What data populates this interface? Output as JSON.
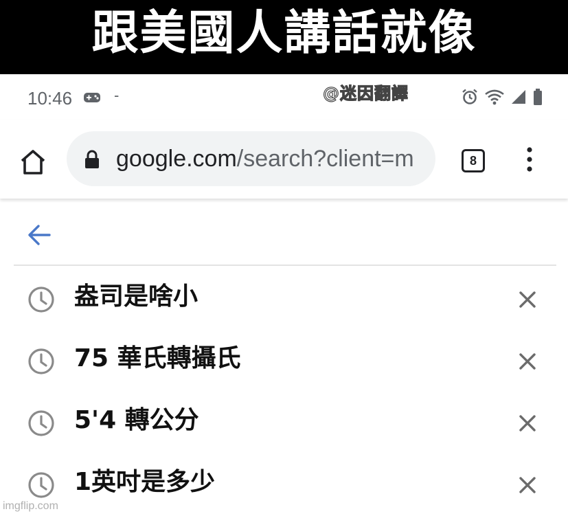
{
  "caption": "跟美國人講話就像",
  "status_bar": {
    "time": "10:46",
    "dash": "-",
    "icons": [
      "game-controller-icon",
      "alarm-icon",
      "wifi-icon",
      "signal-icon",
      "battery-icon"
    ]
  },
  "watermark": "@迷因翻譯",
  "toolbar": {
    "url_domain": "google.com",
    "url_path": "/search?client=m",
    "tab_count": "8"
  },
  "history": [
    {
      "query": "盎司是啥小"
    },
    {
      "query": "75 華氏轉攝氏"
    },
    {
      "query": "5'4 轉公分"
    },
    {
      "query": "1英吋是多少"
    }
  ],
  "footer_watermark": "imgflip.com",
  "colors": {
    "caption_bg": "#000000",
    "caption_text": "#ffffff",
    "back_arrow": "#4a78c8",
    "icon_gray": "#8a8a8a",
    "url_bar_bg": "#f1f3f4"
  }
}
